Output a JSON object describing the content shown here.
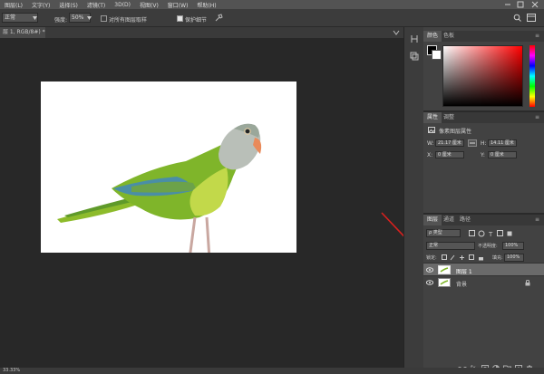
{
  "menu": {
    "items": [
      "图层(L)",
      "文字(Y)",
      "选择(S)",
      "滤镜(T)",
      "3D(D)",
      "视图(V)",
      "窗口(W)",
      "帮助(H)"
    ]
  },
  "options": {
    "mode_value": "正常",
    "opacity_label": "强度:",
    "opacity_value": "50%",
    "sample_all_label": "对所有图层取样",
    "protect_detail_label": "保护细节"
  },
  "document": {
    "tab_title": "层 1, RGB/8#) *",
    "close_glyph": "×"
  },
  "status": {
    "zoom": "33.33%"
  },
  "color_panel": {
    "tabs": [
      "颜色",
      "色板"
    ]
  },
  "properties_panel": {
    "tabs": [
      "属性",
      "调整"
    ],
    "header": "像素图层属性",
    "w_label": "W:",
    "w_value": "21.17 厘米",
    "h_label": "H:",
    "h_value": "14.11 厘米",
    "x_label": "X:",
    "x_value": "0 厘米",
    "y_label": "Y:",
    "y_value": "0 厘米"
  },
  "layers_panel": {
    "tabs": [
      "图层",
      "通道",
      "路径"
    ],
    "filter_value": "ρ 类型",
    "blend_value": "正常",
    "opacity_label": "不透明度:",
    "opacity_value": "100%",
    "lock_label": "锁定:",
    "fill_label": "填充:",
    "fill_value": "100%",
    "layers": [
      {
        "name": "图层 1",
        "selected": true
      },
      {
        "name": "背景",
        "selected": false
      }
    ]
  },
  "annotation": {
    "arrow_color": "#d8201e"
  },
  "colors": {
    "accent": "#d8201e",
    "parrot_green": "#7fb52a",
    "parrot_grey": "#b9bfb8",
    "beak": "#e98a5a"
  },
  "icons": [
    "eye-icon",
    "lock-icon",
    "link-icon",
    "search-icon",
    "arrange-icon",
    "minimize-icon",
    "maximize-icon",
    "close-icon",
    "trash-icon",
    "new-layer-icon",
    "fx-icon",
    "mask-icon",
    "folder-icon",
    "adjustment-icon",
    "brush-icon"
  ]
}
